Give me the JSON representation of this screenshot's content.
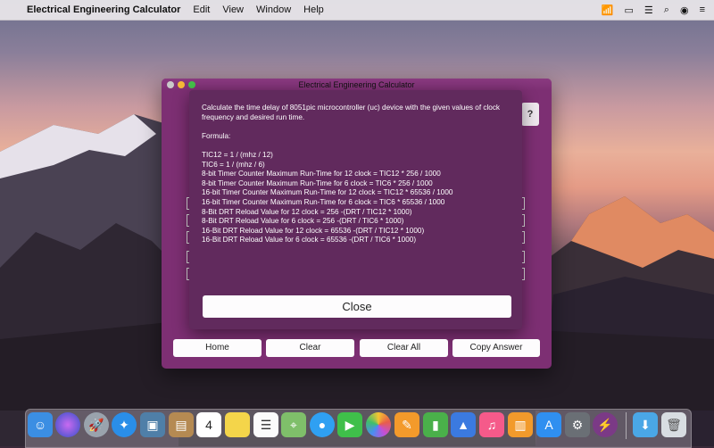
{
  "menubar": {
    "apple": "",
    "app_name": "Electrical Engineering Calculator",
    "menus": [
      "Edit",
      "View",
      "Window",
      "Help"
    ]
  },
  "window": {
    "title": "Electrical Engineering Calculator",
    "help_label": "?"
  },
  "sheet": {
    "intro": "Calculate the time delay of 8051pic microcontroller (uc) device with the given values of clock frequency and desired run time.",
    "formula_heading": "Formula:",
    "formulas": [
      "TIC12 = 1 / (mhz / 12)",
      "TIC6 = 1 / (mhz / 6)",
      "8-bit Timer Counter Maximum Run-Time for 12 clock = TIC12 * 256 / 1000",
      "8-bit Timer Counter Maximum Run-Time for 6 clock = TIC6 * 256 / 1000",
      "16-bit Timer Counter Maximum Run-Time for 12 clock = TIC12 * 65536 / 1000",
      "16-bit Timer Counter Maximum Run-Time for 6 clock = TIC6 * 65536 / 1000",
      "8-Bit DRT Reload Value for 12 clock = 256 -(DRT / TIC12 * 1000)",
      "8-Bit DRT Reload Value for 6 clock = 256 -(DRT / TIC6 * 1000)",
      "16-Bit DRT Reload Value for 12 clock = 65536 -(DRT / TIC12 * 1000)",
      "16-Bit DRT Reload Value for 6 clock = 65536 -(DRT / TIC6 * 1000)"
    ],
    "close_label": "Close"
  },
  "buttons": {
    "home": "Home",
    "clear": "Clear",
    "clear_all": "Clear All",
    "copy_answer": "Copy Answer"
  },
  "dock": {
    "icons": [
      "finder-icon",
      "siri-icon",
      "launchpad-icon",
      "safari-icon",
      "photo-viewer-icon",
      "contacts-icon",
      "calendar-icon",
      "notes-icon",
      "reminders-icon",
      "maps-icon",
      "messages-icon",
      "facetime-icon",
      "photos-icon",
      "pages-icon",
      "numbers-icon",
      "keynote-icon",
      "music-icon",
      "books-icon",
      "app-store-icon",
      "system-preferences-icon",
      "app-icon",
      "downloads-folder-icon",
      "trash-icon"
    ],
    "calendar_day": "4"
  },
  "colors": {
    "window_bg": "#7d2f73",
    "sheet_bg": "#612a5d",
    "button_bg": "#fdfcfd"
  }
}
